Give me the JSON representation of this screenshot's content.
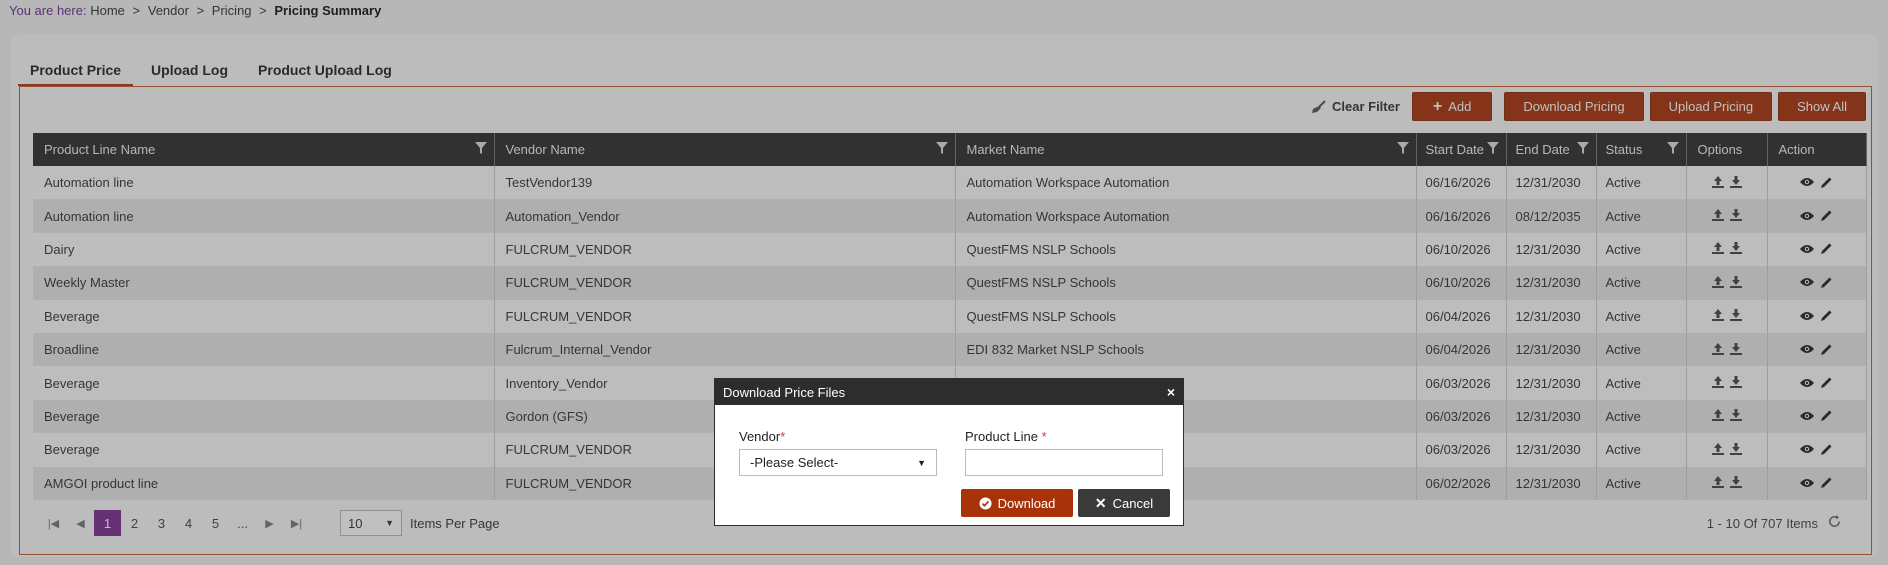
{
  "breadcrumb": {
    "lead": "You are here:",
    "items": [
      "Home",
      "Vendor",
      "Pricing"
    ],
    "current": "Pricing Summary",
    "separator": ">"
  },
  "tabs": [
    {
      "label": "Product Price",
      "active": true
    },
    {
      "label": "Upload Log",
      "active": false
    },
    {
      "label": "Product Upload Log",
      "active": false
    }
  ],
  "toolbar": {
    "clear_filter": "Clear Filter",
    "add": "Add",
    "download_pricing": "Download Pricing",
    "upload_pricing": "Upload Pricing",
    "show_all": "Show All"
  },
  "table": {
    "columns": [
      "Product Line Name",
      "Vendor Name",
      "Market Name",
      "Start Date",
      "End Date",
      "Status",
      "Options",
      "Action"
    ],
    "rows": [
      [
        "Automation line",
        "TestVendor139",
        "Automation Workspace Automation",
        "06/16/2026",
        "12/31/2030",
        "Active"
      ],
      [
        "Automation line",
        "Automation_Vendor",
        "Automation Workspace Automation",
        "06/16/2026",
        "08/12/2035",
        "Active"
      ],
      [
        "Dairy",
        "FULCRUM_VENDOR",
        "QuestFMS NSLP Schools",
        "06/10/2026",
        "12/31/2030",
        "Active"
      ],
      [
        "Weekly Master",
        "FULCRUM_VENDOR",
        "QuestFMS NSLP Schools",
        "06/10/2026",
        "12/31/2030",
        "Active"
      ],
      [
        "Beverage",
        "FULCRUM_VENDOR",
        "QuestFMS NSLP Schools",
        "06/04/2026",
        "12/31/2030",
        "Active"
      ],
      [
        "Broadline",
        "Fulcrum_Internal_Vendor",
        "EDI 832 Market NSLP Schools",
        "06/04/2026",
        "12/31/2030",
        "Active"
      ],
      [
        "Beverage",
        "Inventory_Vendor",
        "",
        "06/03/2026",
        "12/31/2030",
        "Active"
      ],
      [
        "Beverage",
        "Gordon (GFS)",
        "",
        "06/03/2026",
        "12/31/2030",
        "Active"
      ],
      [
        "Beverage",
        "FULCRUM_VENDOR",
        "",
        "06/03/2026",
        "12/31/2030",
        "Active"
      ],
      [
        "AMGOI product line",
        "FULCRUM_VENDOR",
        "",
        "06/02/2026",
        "12/31/2030",
        "Active"
      ]
    ]
  },
  "pager": {
    "pages": [
      "1",
      "2",
      "3",
      "4",
      "5",
      "..."
    ],
    "current": "1",
    "per_page": "10",
    "per_page_label": "Items Per Page",
    "range_text": "1 - 10 Of 707 Items"
  },
  "modal": {
    "title": "Download Price Files",
    "close": "×",
    "vendor_label": "Vendor",
    "vendor_value": "-Please Select-",
    "product_line_label": "Product Line",
    "product_line_value": "",
    "required_mark": "*",
    "download": "Download",
    "cancel": "Cancel"
  },
  "colors": {
    "accent": "#a8320a",
    "header": "#2d2d2d",
    "pager_current": "#7b2d8e"
  }
}
